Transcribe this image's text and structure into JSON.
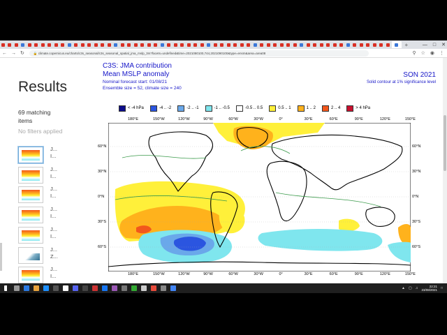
{
  "browser": {
    "url": "climate.copernicus.eu/charts/c3s_seasonal/c3s_seasonal_spatial_jma_mslp_3m?facets=undefined&time=2021080100,744,2021090100&type=ensm&area=area08",
    "tab_count": 60,
    "accent_tab_color": "#d93025"
  },
  "sidebar": {
    "title": "Results",
    "matching": "69 matching items",
    "no_filters": "No filters applied",
    "items": [
      {
        "short": "J...",
        "second": "I..."
      },
      {
        "short": "J...",
        "second": "I..."
      },
      {
        "short": "J...",
        "second": "I..."
      },
      {
        "short": "J...",
        "second": "I..."
      },
      {
        "short": "J...",
        "second": "I..."
      },
      {
        "short": "J...",
        "second": "Z..."
      },
      {
        "short": "J...",
        "second": "I..."
      }
    ]
  },
  "chart": {
    "line1": "C3S: JMA contribution",
    "line2": "Mean MSLP anomaly",
    "line3": "Nominal forecast start: 01/08/21",
    "line4": "Ensemble size = 52, climate size = 240",
    "season": "SON 2021",
    "significance": "Solid contour at 1% significance level",
    "legend": [
      {
        "label": "< -4 hPa",
        "color": "#0d0d8a"
      },
      {
        "label": "-4 .. -2",
        "color": "#2b55e0"
      },
      {
        "label": "-2 .. -1",
        "color": "#6aa8ea"
      },
      {
        "label": "-1 .. -0.5",
        "color": "#7fe6ee"
      },
      {
        "label": "-0.5 .. 0.5",
        "color": "#ffffff"
      },
      {
        "label": "0.5 .. 1",
        "color": "#fff03a"
      },
      {
        "label": "1 .. 2",
        "color": "#ffb21c"
      },
      {
        "label": "2 .. 4",
        "color": "#f2571c"
      },
      {
        "label": "> 4 hPa",
        "color": "#c8102e"
      }
    ],
    "lon_labels": [
      "180°E",
      "150°W",
      "120°W",
      "90°W",
      "60°W",
      "30°W",
      "0°",
      "30°E",
      "60°E",
      "90°E",
      "120°E",
      "150°E"
    ],
    "lat_labels": [
      "60°N",
      "30°N",
      "0°N",
      "30°S",
      "60°S"
    ]
  },
  "taskbar": {
    "time": "22:21",
    "date": "23/08/2021"
  }
}
